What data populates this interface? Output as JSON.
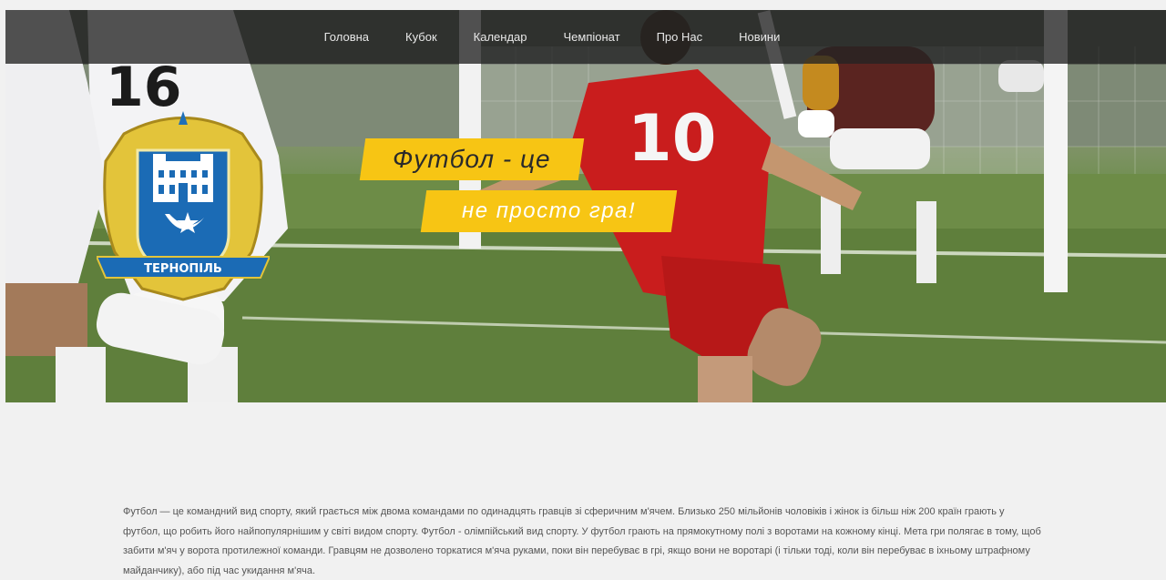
{
  "nav": {
    "items": [
      {
        "label": "Головна"
      },
      {
        "label": "Кубок"
      },
      {
        "label": "Календар"
      },
      {
        "label": "Чемпіонат"
      },
      {
        "label": "Про Нас"
      },
      {
        "label": "Новини"
      }
    ]
  },
  "hero": {
    "slogan_line1": "Футбол - це",
    "slogan_line2": "не просто гра!",
    "crest_text": "ТЕРНОПІЛЬ",
    "player_number_left": "16",
    "player_number_center": "10"
  },
  "main": {
    "paragraph": "Футбол — це командний вид спорту, який грається між двома командами по одинадцять гравців зі сферичним м'ячем. Близько 250 мільйонів чоловіків і жінок із більш ніж 200 країн грають у футбол, що робить його найпопулярнішим у світі видом спорту. Футбол - олімпійський вид спорту. У футбол грають на прямокутному полі з воротами на кожному кінці. Мета гри полягає в тому, щоб забити м'яч у ворота протилежної команди. Гравцям не дозволено торкатися м'яча руками, поки він перебуває в грі, якщо вони не воротарі (і тільки тоді, коли він перебуває в іхньому штрафному майданчику), або під час укидання м'яча."
  },
  "colors": {
    "accent": "#f7c514",
    "nav_bg": "#232323",
    "page_bg": "#f1f1f1"
  }
}
